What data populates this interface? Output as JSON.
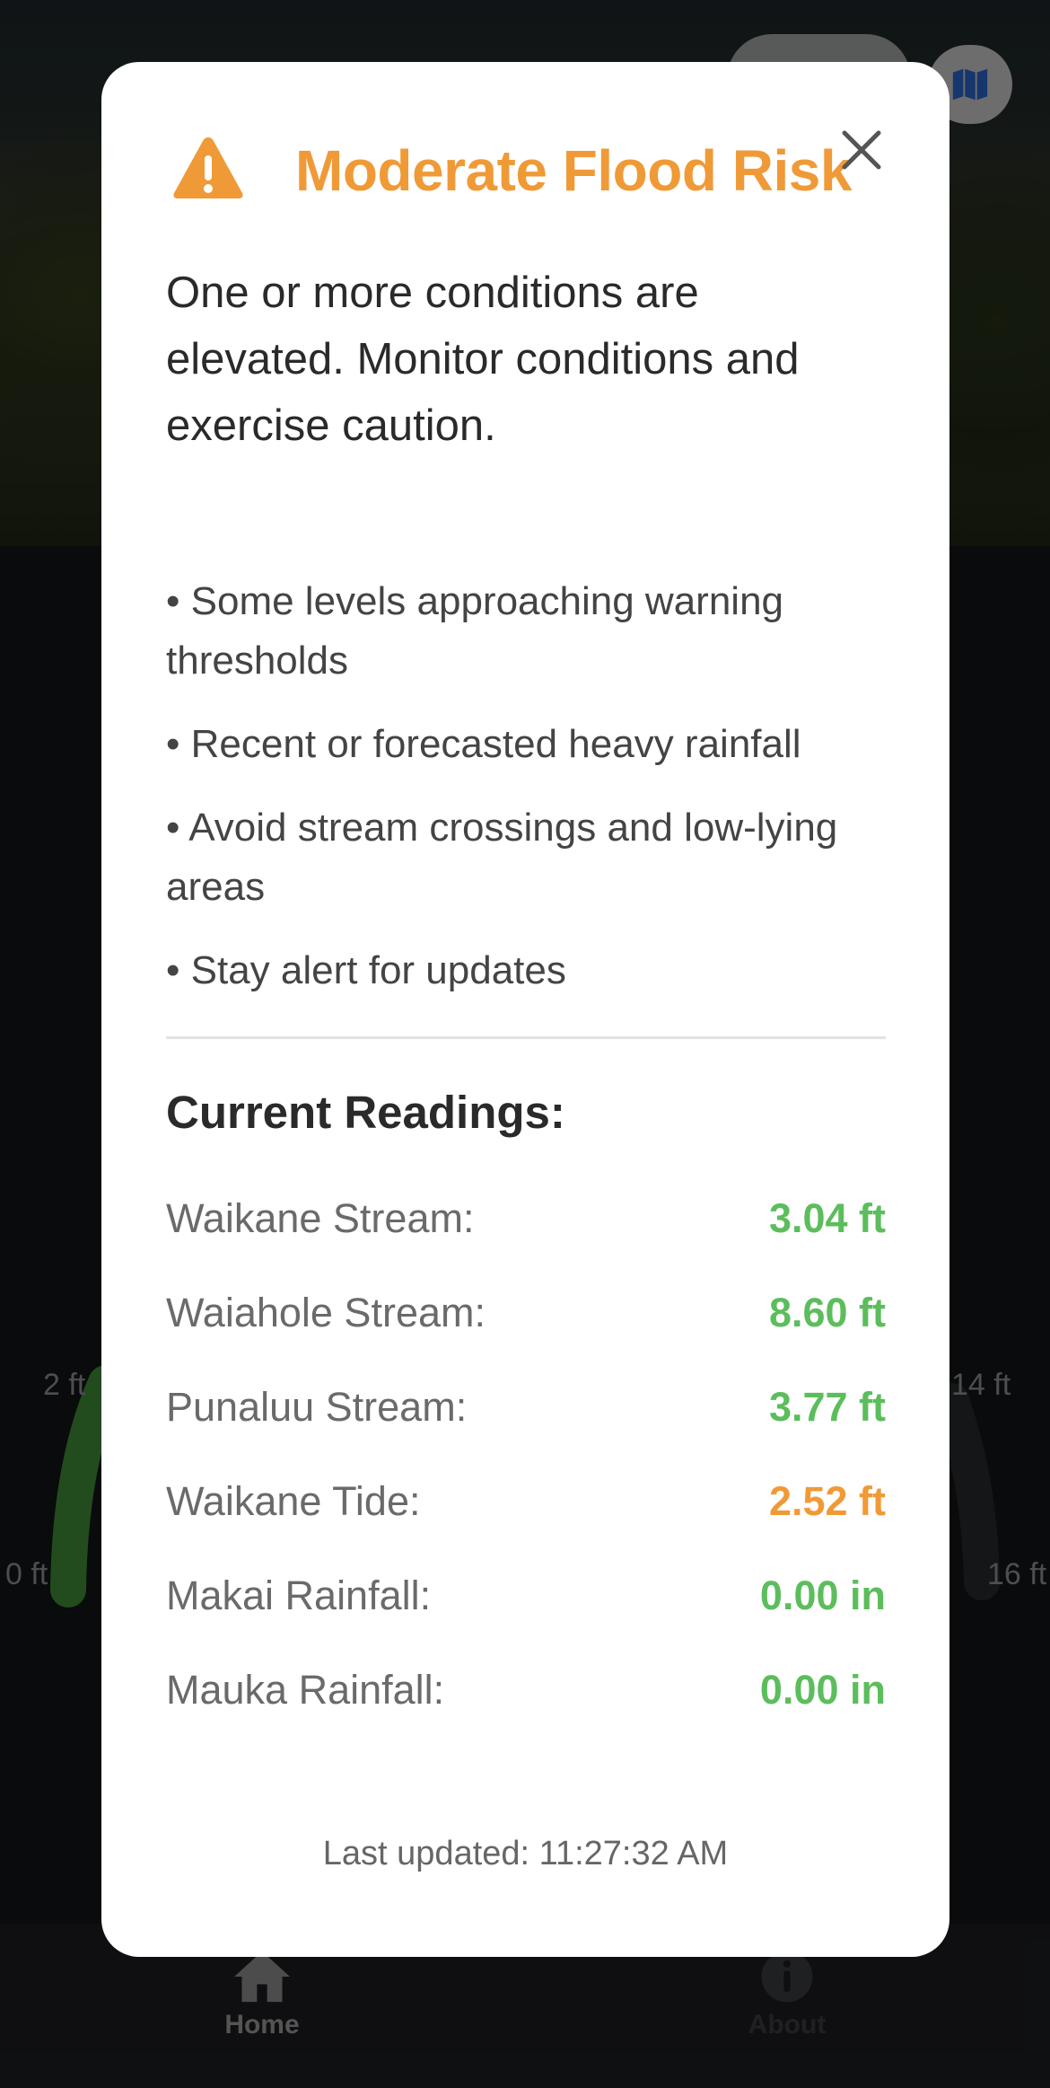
{
  "colors": {
    "warning_orange": "#f09a37",
    "normal_green": "#5cbd5c",
    "gauge_green": "#3e8a36",
    "map_icon_blue": "#2a63c9"
  },
  "gauge": {
    "left_top_label": "2 ft",
    "left_bottom_label": "0 ft",
    "right_top_label": "14 ft",
    "right_bottom_label": "16 ft"
  },
  "tabs": [
    {
      "label": "Home",
      "icon": "home-icon",
      "active": true
    },
    {
      "label": "About",
      "icon": "info-icon",
      "active": false
    }
  ],
  "modal": {
    "icon": "warning-triangle-icon",
    "title": "Moderate Flood Risk",
    "summary": "One or more conditions are elevated. Monitor conditions and exercise caution.",
    "bullets": [
      "• Some levels approaching warning thresholds",
      "• Recent or forecasted heavy rainfall",
      "• Avoid stream crossings and low-lying areas",
      "• Stay alert for updates"
    ],
    "readings_title": "Current Readings:",
    "readings": [
      {
        "name": "Waikane Stream:",
        "value": "3.04 ft",
        "status": "normal"
      },
      {
        "name": "Waiahole Stream:",
        "value": "8.60 ft",
        "status": "normal"
      },
      {
        "name": "Punaluu Stream:",
        "value": "3.77 ft",
        "status": "normal"
      },
      {
        "name": "Waikane Tide:",
        "value": "2.52 ft",
        "status": "warning"
      },
      {
        "name": "Makai Rainfall:",
        "value": "0.00 in",
        "status": "normal"
      },
      {
        "name": "Mauka Rainfall:",
        "value": "0.00 in",
        "status": "normal"
      }
    ],
    "last_updated": "Last updated: 11:27:32 AM"
  }
}
